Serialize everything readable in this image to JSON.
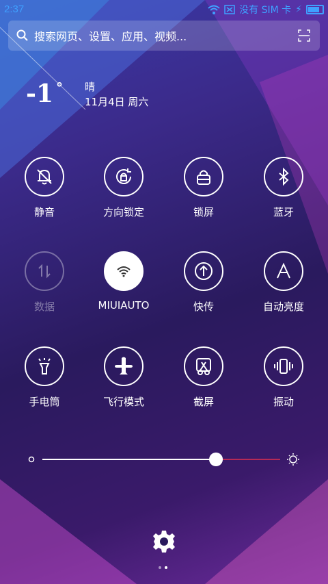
{
  "status": {
    "time": "2:37",
    "sim": "没有 SIM 卡",
    "wifi_icon": "wifi-icon",
    "battery_icon": "battery-icon"
  },
  "search": {
    "placeholder": "搜索网页、设置、应用、视频..."
  },
  "weather": {
    "temp": "-1",
    "degree": "°",
    "condition": "晴",
    "date": "11月4日 周六"
  },
  "toggles": [
    {
      "label": "静音",
      "icon": "bell-muted-icon",
      "state": "off"
    },
    {
      "label": "方向锁定",
      "icon": "rotation-lock-icon",
      "state": "off"
    },
    {
      "label": "锁屏",
      "icon": "lock-icon",
      "state": "off"
    },
    {
      "label": "蓝牙",
      "icon": "bluetooth-icon",
      "state": "off"
    },
    {
      "label": "数据",
      "icon": "mobile-data-icon",
      "state": "disabled"
    },
    {
      "label": "MIUIAUTO",
      "icon": "wifi-icon",
      "state": "on"
    },
    {
      "label": "快传",
      "icon": "share-icon",
      "state": "off"
    },
    {
      "label": "自动亮度",
      "icon": "auto-brightness-icon",
      "state": "off"
    },
    {
      "label": "手电筒",
      "icon": "flashlight-icon",
      "state": "off"
    },
    {
      "label": "飞行模式",
      "icon": "airplane-icon",
      "state": "off"
    },
    {
      "label": "截屏",
      "icon": "screenshot-icon",
      "state": "off"
    },
    {
      "label": "振动",
      "icon": "vibrate-icon",
      "state": "off"
    }
  ],
  "brightness": {
    "level": 0.73
  },
  "colors": {
    "status_blue": "#3fa0ff",
    "slider_track_right": "#e03050"
  }
}
